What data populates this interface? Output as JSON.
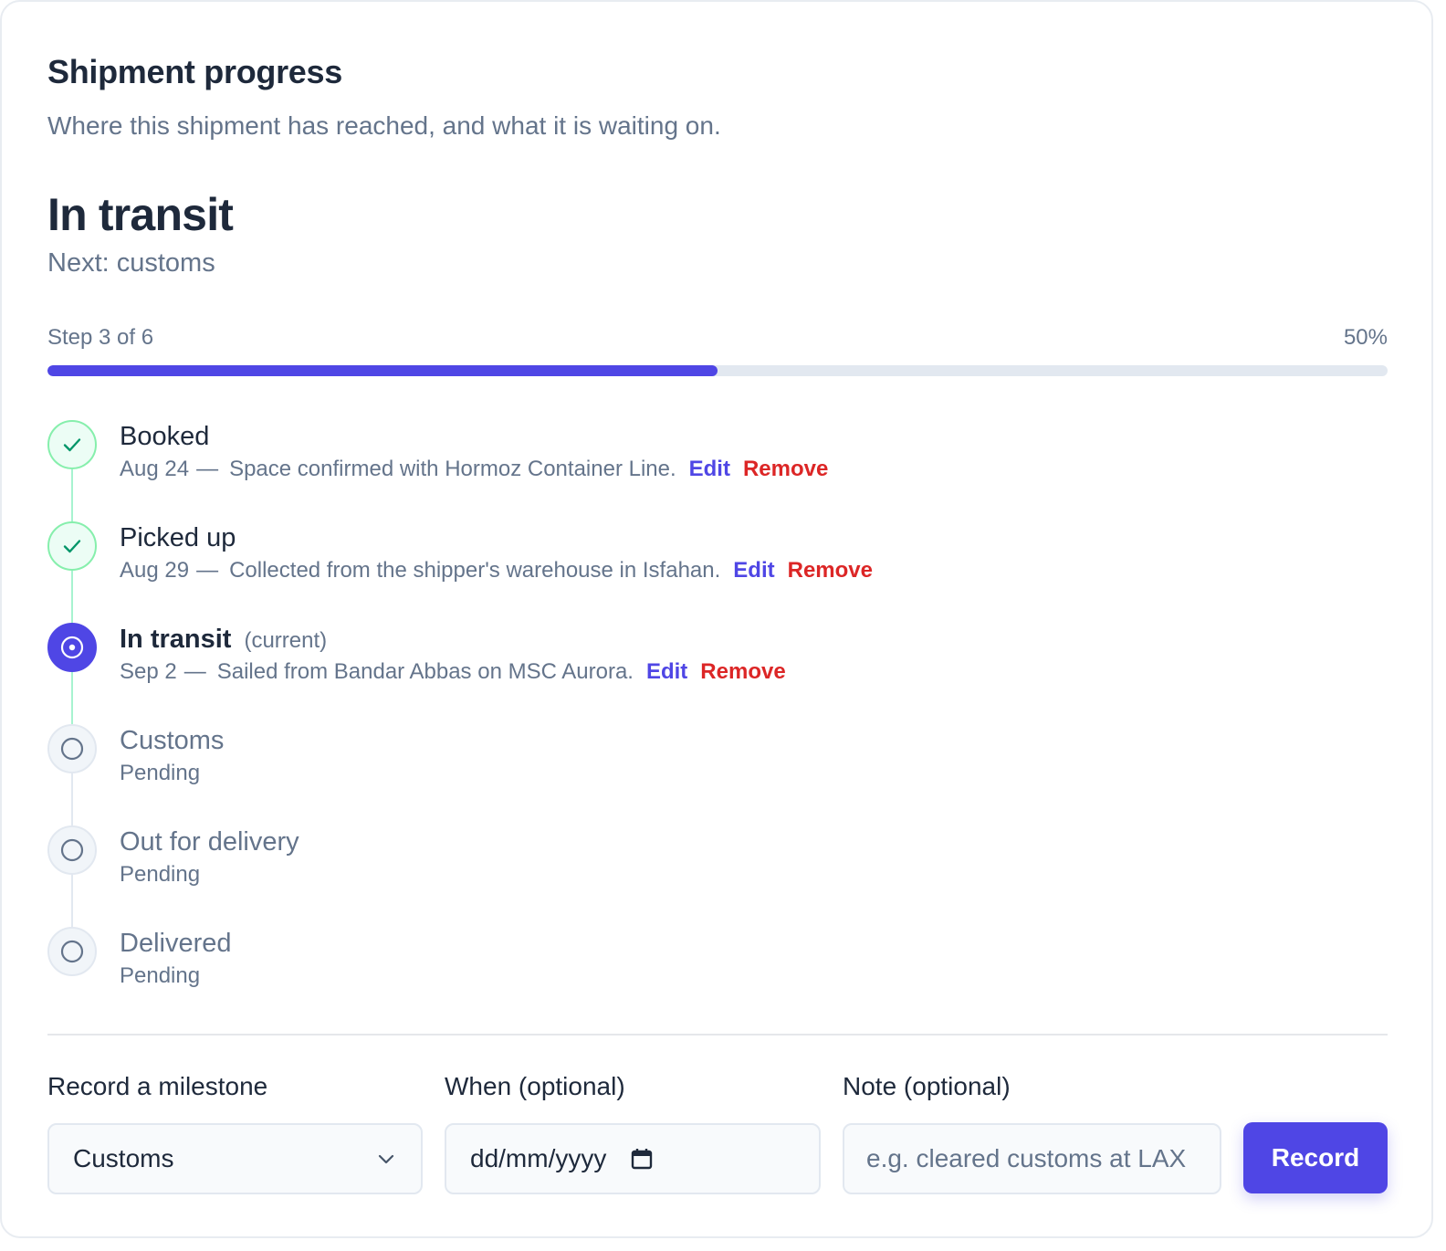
{
  "header": {
    "title": "Shipment progress",
    "subtitle": "Where this shipment has reached, and what it is waiting on."
  },
  "status": {
    "current": "In transit",
    "next": "Next: customs"
  },
  "progress": {
    "step_text": "Step 3 of 6",
    "percent_text": "50%",
    "percent": 50
  },
  "milestones": [
    {
      "name": "Booked",
      "state": "done",
      "date": "Aug 24",
      "note": "Space confirmed with Hormoz Container Line.",
      "edit_label": "Edit",
      "remove_label": "Remove"
    },
    {
      "name": "Picked up",
      "state": "done",
      "date": "Aug 29",
      "note": "Collected from the shipper's warehouse in Isfahan.",
      "edit_label": "Edit",
      "remove_label": "Remove"
    },
    {
      "name": "In transit",
      "state": "current",
      "tag": "(current)",
      "date": "Sep 2",
      "note": "Sailed from Bandar Abbas on MSC Aurora.",
      "edit_label": "Edit",
      "remove_label": "Remove"
    },
    {
      "name": "Customs",
      "state": "pending",
      "status": "Pending"
    },
    {
      "name": "Out for delivery",
      "state": "pending",
      "status": "Pending"
    },
    {
      "name": "Delivered",
      "state": "pending",
      "status": "Pending"
    }
  ],
  "form": {
    "milestone_label": "Record a milestone",
    "milestone_value": "Customs",
    "when_label": "When (optional)",
    "when_placeholder": "dd/mm/yyyy",
    "note_label": "Note (optional)",
    "note_placeholder": "e.g. cleared customs at LAX",
    "record_label": "Record"
  },
  "colors": {
    "accent": "#4f46e5",
    "done_fill": "#ecfdf5",
    "done_border": "#86efac",
    "done_check": "#059669",
    "danger": "#dc2626",
    "muted_text": "#64748b",
    "track": "#e2e8f0"
  },
  "icons": {
    "done": "check-icon",
    "current": "current-dot-icon",
    "pending": "empty-circle-icon",
    "select": "chevron-down-icon",
    "date": "calendar-icon"
  }
}
